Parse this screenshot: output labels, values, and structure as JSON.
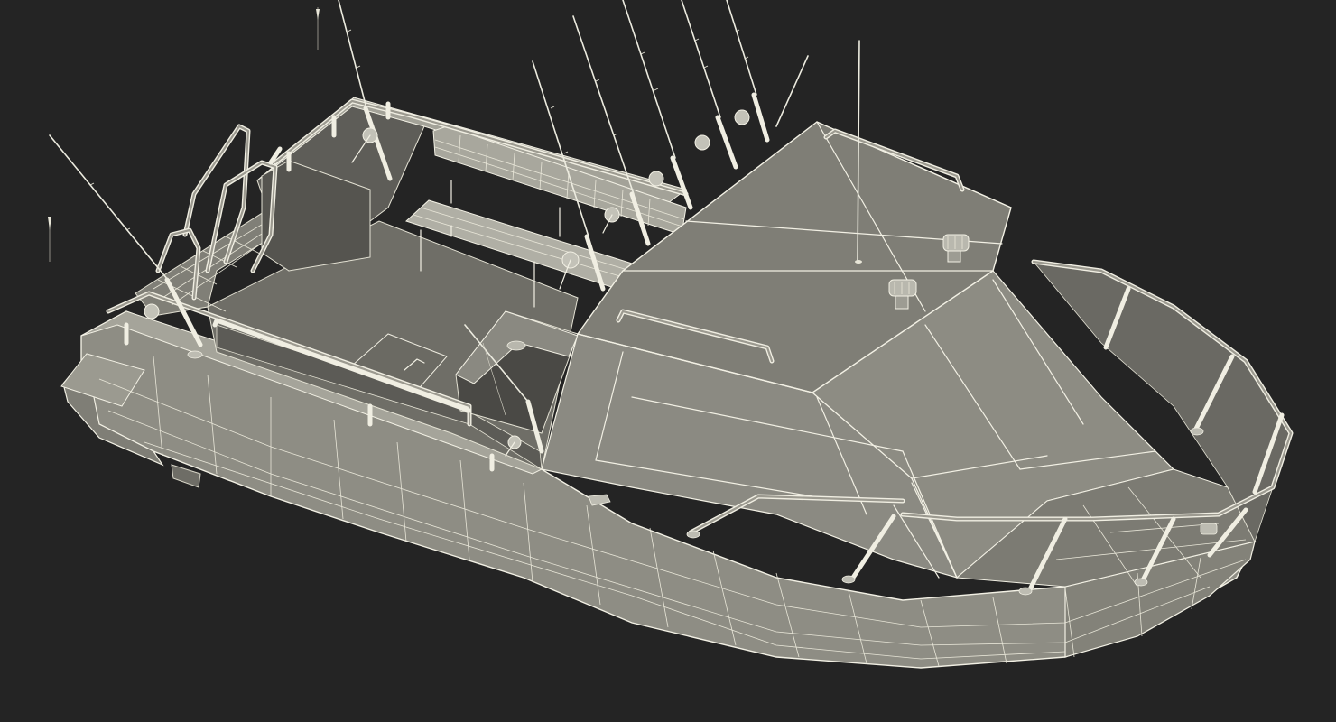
{
  "scene": {
    "subject": "fishing-boat-wireframe-render",
    "colors": {
      "background": "#242424",
      "hull": "#8f8e85",
      "hull_dark": "#7b7a72",
      "hull_light": "#a09f95",
      "deck": "#6d6c65",
      "interior": "#5a5954",
      "wire": "#f2f0e4"
    },
    "fishing_rod_count": 10,
    "rod_holder_count": 10
  }
}
